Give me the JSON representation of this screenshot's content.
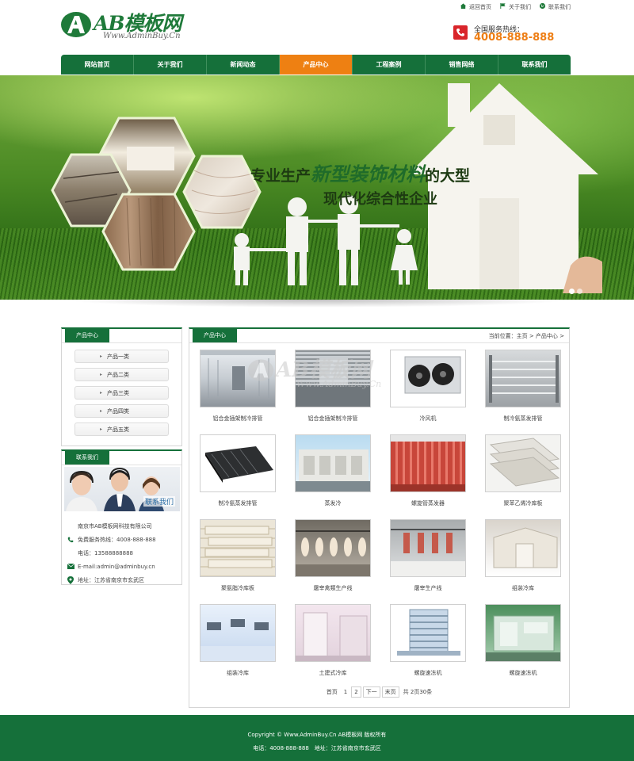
{
  "header": {
    "logo_text": "AB模板网",
    "logo_sub": "Www.AdminBuy.Cn",
    "top_links": [
      {
        "label": "返回首页",
        "icon": "home-icon"
      },
      {
        "label": "关于我们",
        "icon": "flag-icon"
      },
      {
        "label": "联系我们",
        "icon": "globe-icon"
      }
    ],
    "hotline_label": "全国服务热线：",
    "hotline_number": "4008-888-888"
  },
  "nav": {
    "items": [
      "网站首页",
      "关于我们",
      "新闻动态",
      "产品中心",
      "工程案例",
      "销售网络",
      "联系我们"
    ],
    "active_index": 3
  },
  "banner": {
    "line1_pre": "专业生产",
    "line1_highlight": "新型装饰材料",
    "line1_post": "的大型",
    "line2": "现代化综合性企业",
    "slide_count": 2,
    "active_slide": 0
  },
  "sidebar": {
    "title": "产品中心",
    "categories": [
      "产品一类",
      "产品二类",
      "产品三类",
      "产品四类",
      "产品五类"
    ]
  },
  "contact": {
    "title": "联系我们",
    "photo_label": "联系我们",
    "company": "南京市AB模板网科技有限公司",
    "hotline": "免费服务热线：4008-888-888",
    "phone": "电话：13588888888",
    "email": "E-mail:admin@adminbuy.cn",
    "address": "地址：江苏省南京市玄武区"
  },
  "main": {
    "title": "产品中心",
    "breadcrumb": "当前位置：主页 > 产品中心 >",
    "products": [
      {
        "name": "铝合金插架制冷排管"
      },
      {
        "name": "铝合金插架制冷排管"
      },
      {
        "name": "冷风机"
      },
      {
        "name": "制冷氨蒸发排管"
      },
      {
        "name": "制冷氨蒸发排管"
      },
      {
        "name": "蒸发冷"
      },
      {
        "name": "螺旋管蒸发器"
      },
      {
        "name": "聚苯乙烯冷库板"
      },
      {
        "name": "聚氨脂冷库板"
      },
      {
        "name": "屠宰禽類生产线"
      },
      {
        "name": "屠宰生产线"
      },
      {
        "name": "组装冷库"
      },
      {
        "name": "组装冷库"
      },
      {
        "name": "土建式冷库"
      },
      {
        "name": "螺旋速冻机"
      },
      {
        "name": "螺旋速冻机"
      }
    ],
    "watermark_text": "AB模板网",
    "watermark_sub": "Www.AdminBuy.Cn"
  },
  "pager": {
    "first": "首页",
    "page1": "1",
    "page2": "2",
    "next": "下一",
    "last": "末页",
    "summary": "共 2页30条"
  },
  "footer": {
    "line1": "Copyright © Www.AdminBuy.Cn AB模板网 版权所有",
    "line2": "电话：4008-888-888　地址：江苏省南京市玄武区"
  },
  "colors": {
    "brand_green": "#15703a",
    "accent_orange": "#ee8012",
    "hotline_orange": "#ee7d12",
    "phone_red": "#d9252a"
  }
}
